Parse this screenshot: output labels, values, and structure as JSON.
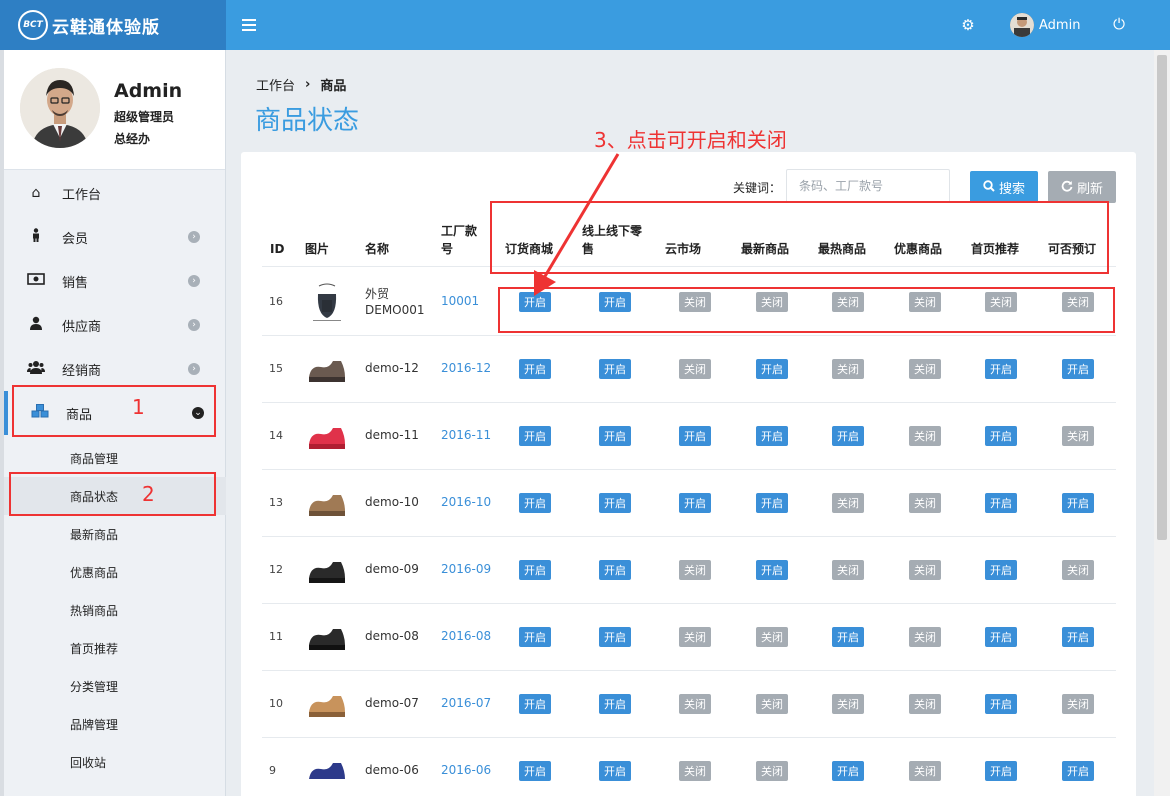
{
  "app": {
    "title": "云鞋通体验版",
    "logo_text": "BCT"
  },
  "header": {
    "user": "Admin",
    "icons": [
      "menu-icon",
      "gear-icon",
      "power-icon"
    ]
  },
  "profile": {
    "name": "Admin",
    "role": "超级管理员",
    "title": "总经办"
  },
  "sidebar": {
    "items": [
      {
        "label": "工作台",
        "icon": "home-icon"
      },
      {
        "label": "会员",
        "icon": "person-icon"
      },
      {
        "label": "销售",
        "icon": "money-icon"
      },
      {
        "label": "供应商",
        "icon": "user-icon"
      },
      {
        "label": "经销商",
        "icon": "users-icon"
      },
      {
        "label": "商品",
        "icon": "cubes-icon"
      }
    ],
    "sub_items": [
      {
        "label": "商品管理"
      },
      {
        "label": "商品状态"
      },
      {
        "label": "最新商品"
      },
      {
        "label": "优惠商品"
      },
      {
        "label": "热销商品"
      },
      {
        "label": "首页推荐"
      },
      {
        "label": "分类管理"
      },
      {
        "label": "品牌管理"
      },
      {
        "label": "回收站"
      }
    ]
  },
  "breadcrumb": {
    "home": "工作台",
    "sep": "›",
    "current": "商品"
  },
  "page_title": "商品状态",
  "search": {
    "label": "关键词：",
    "placeholder": "条码、工厂款号",
    "search_button": "搜索",
    "refresh_button": "刷新"
  },
  "table": {
    "headers": {
      "id": "ID",
      "image": "图片",
      "name": "名称",
      "code": "工厂款号",
      "flags": [
        "订货商城",
        "线上线下零售",
        "云市场",
        "最新商品",
        "最热商品",
        "优惠商品",
        "首页推荐",
        "可否预订"
      ]
    },
    "on_label": "开启",
    "off_label": "关闭",
    "rows": [
      {
        "id": "16",
        "name": "外贸DEMO001",
        "code": "10001",
        "flags": [
          1,
          1,
          0,
          0,
          0,
          0,
          0,
          0
        ]
      },
      {
        "id": "15",
        "name": "demo-12",
        "code": "2016-12",
        "flags": [
          1,
          1,
          0,
          1,
          0,
          0,
          1,
          1
        ]
      },
      {
        "id": "14",
        "name": "demo-11",
        "code": "2016-11",
        "flags": [
          1,
          1,
          1,
          1,
          1,
          0,
          1,
          0
        ]
      },
      {
        "id": "13",
        "name": "demo-10",
        "code": "2016-10",
        "flags": [
          1,
          1,
          1,
          1,
          0,
          0,
          1,
          1
        ]
      },
      {
        "id": "12",
        "name": "demo-09",
        "code": "2016-09",
        "flags": [
          1,
          1,
          0,
          1,
          0,
          0,
          1,
          0
        ]
      },
      {
        "id": "11",
        "name": "demo-08",
        "code": "2016-08",
        "flags": [
          1,
          1,
          0,
          0,
          1,
          0,
          1,
          1
        ]
      },
      {
        "id": "10",
        "name": "demo-07",
        "code": "2016-07",
        "flags": [
          1,
          1,
          0,
          0,
          0,
          0,
          1,
          0
        ]
      },
      {
        "id": "9",
        "name": "demo-06",
        "code": "2016-06",
        "flags": [
          1,
          1,
          0,
          0,
          1,
          0,
          1,
          1
        ]
      }
    ]
  },
  "annotations": {
    "n1": "1",
    "n2": "2",
    "n3": "3、点击可开启和关闭"
  },
  "colors": {
    "primary": "#3a9ce0",
    "brand": "#2e7fc4",
    "on": "#3a8fd8",
    "off": "#a5acb3",
    "annotation": "#e33333"
  }
}
